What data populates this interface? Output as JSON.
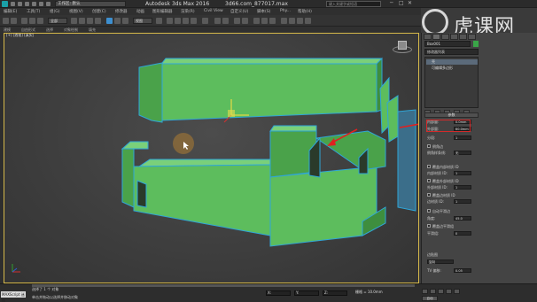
{
  "titlebar": {
    "workspace": "工作区: 默认",
    "app_title": "Autodesk 3ds Max 2016",
    "file_title": "3d66.com_877017.max",
    "search_placeholder": "键入关键字或短语",
    "min": "─",
    "max": "□",
    "close": "✕"
  },
  "brand": {
    "logo_text": "虎课网"
  },
  "menu": [
    "编辑(E)",
    "工具(T)",
    "组(G)",
    "视图(V)",
    "创建(C)",
    "修改器",
    "动画",
    "图形编辑器",
    "渲染(R)",
    "Civil View",
    "自定义(U)",
    "脚本(S)",
    "Phy...",
    "帮助(H)"
  ],
  "toolbar": {
    "filter": "全部",
    "view": "视图"
  },
  "ribbon": [
    "建模",
    "自由形式",
    "选择",
    "对象绘制",
    "填充"
  ],
  "viewport": {
    "label": "[+] [透视] [真实]"
  },
  "command_panel": {
    "object_name": "Box001",
    "modifier_list": "修改器列表",
    "stack": [
      "壳",
      "可编辑多边形"
    ],
    "rollout_title": "参数",
    "params": [
      {
        "label": "内部量:",
        "value": "0.0mm"
      },
      {
        "label": "外部量:",
        "value": "60.0mm"
      },
      {
        "label": "分段:",
        "value": "1"
      }
    ],
    "options": [
      {
        "label": "倒角边"
      },
      {
        "label": "倒角样条线:",
        "value": "无"
      },
      {
        "label": "覆盖内部材质 ID"
      },
      {
        "label": "内部材质 ID:",
        "value": "1"
      },
      {
        "label": "覆盖外部材质 ID"
      },
      {
        "label": "外部材质 ID:",
        "value": "1"
      },
      {
        "label": "覆盖边材质 ID"
      },
      {
        "label": "边材质 ID:",
        "value": "1"
      },
      {
        "label": "自动平滑边"
      },
      {
        "label": "角度:",
        "value": "45.0"
      },
      {
        "label": "覆盖边平滑组"
      },
      {
        "label": "平滑组:",
        "value": "0"
      },
      {
        "label": "边贴图"
      },
      {
        "label": "复制"
      },
      {
        "label": "TV 偏移:",
        "value": "0.05"
      }
    ]
  },
  "status": {
    "maxscript": "MAXScript 迷你",
    "line1": "选择了 1 个 对象",
    "line2": "单击并拖动以选择并移动对象",
    "x": "X:",
    "y": "Y:",
    "z": "Z:",
    "grid": "栅格 = 10.0mm",
    "auto_key": "自动"
  },
  "colors": {
    "wall": "#5dbd5d",
    "outline": "#2fa6d8",
    "arrow": "#e02020",
    "cursor": "#8a6a3a"
  }
}
